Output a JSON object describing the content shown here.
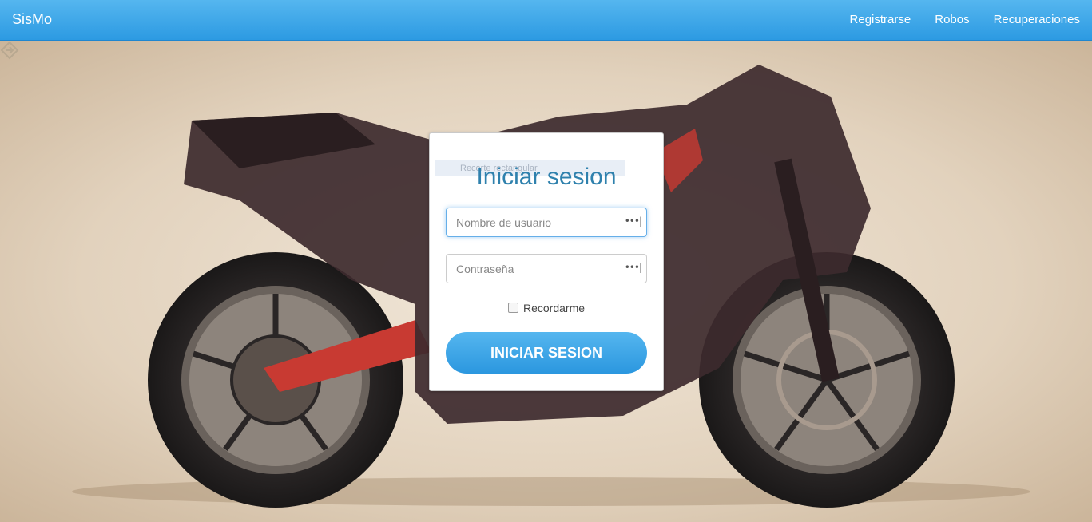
{
  "navbar": {
    "brand": "SisMo",
    "links": [
      "Registrarse",
      "Robos",
      "Recuperaciones"
    ]
  },
  "login": {
    "ghost_label": "Recorte rectangular",
    "title": "Iniciar sesion",
    "username_placeholder": "Nombre de usuario",
    "password_placeholder": "Contraseña",
    "remember_label": "Recordarme",
    "submit_label": "INICIAR SESION",
    "password_icon": "•••|"
  },
  "colors": {
    "nav": "#2c9ae2",
    "title": "#2f81ad",
    "button": "#2b97df"
  }
}
